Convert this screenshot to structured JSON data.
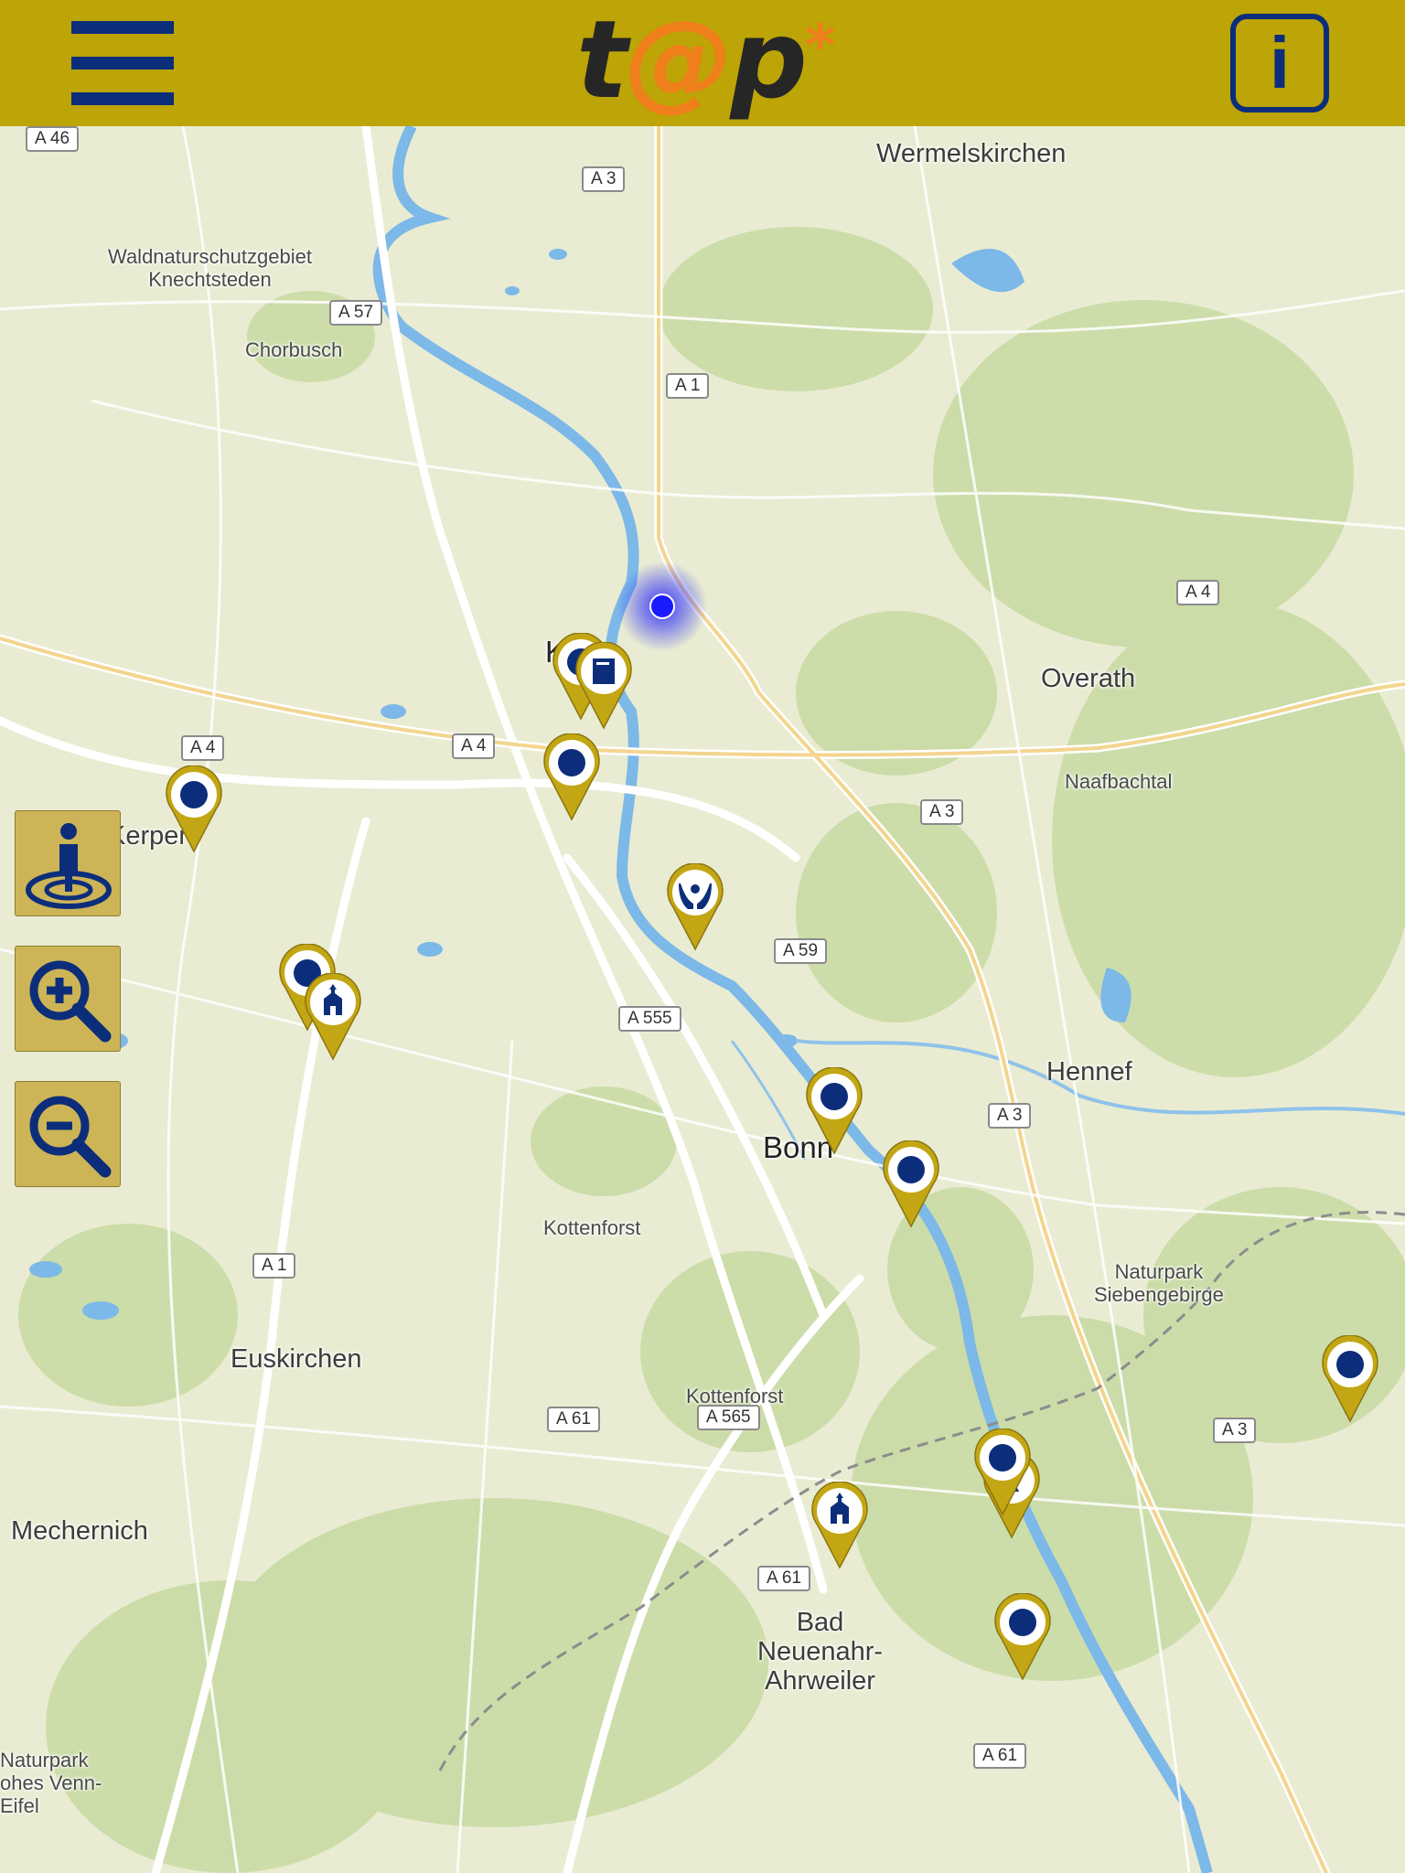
{
  "header": {
    "logo": {
      "t": "t",
      "at": "@",
      "p": "p",
      "star": "*"
    },
    "menu_icon": "hamburger-menu-icon",
    "info_label": "i",
    "colors": {
      "bar": "#bda407",
      "icon": "#0c2e7a",
      "logo_text": "#262626",
      "logo_accent": "#ef7f1a"
    }
  },
  "map": {
    "places": {
      "wermelskirchen": "Wermelskirchen",
      "knechtsteden": "Waldnaturschutzgebiet\nKnechtsteden",
      "chorbusch": "Chorbusch",
      "koeln": "Köln",
      "overath": "Overath",
      "naafbachtal": "Naafbachtal",
      "kerpen": "Kerpen",
      "hennef": "Hennef",
      "bonn": "Bonn",
      "kottenforst1": "Kottenforst",
      "kottenforst2": "Kottenforst",
      "siebengebirge": "Naturpark\nSiebengebirge",
      "euskirchen": "Euskirchen",
      "mechernich": "Mechernich",
      "ahrweiler": "Bad\nNeuenahr-\nAhrweiler",
      "hohesvenn": "Naturpark\nohes Venn-\nEifel"
    },
    "roads": {
      "a46": "A 46",
      "a3_n": "A 3",
      "a57": "A 57",
      "a1_n": "A 1",
      "a4_e": "A 4",
      "a4_w": "A 4",
      "a4_c": "A 4",
      "a3_e": "A 3",
      "a59": "A 59",
      "a555": "A 555",
      "a3_se": "A 3",
      "a1_s": "A 1",
      "a61_w": "A 61",
      "a565": "A 565",
      "a61_c": "A 61",
      "a3_far": "A 3",
      "a61_s": "A 61"
    },
    "markers": [
      {
        "name": "poi-marker",
        "icon": "dot-icon"
      },
      {
        "name": "poi-marker",
        "icon": "book-icon"
      },
      {
        "name": "poi-marker",
        "icon": "dot-icon"
      },
      {
        "name": "poi-marker",
        "icon": "dot-icon"
      },
      {
        "name": "poi-marker",
        "icon": "helping-hands-icon"
      },
      {
        "name": "poi-marker",
        "icon": "dot-icon"
      },
      {
        "name": "poi-marker",
        "icon": "church-icon"
      },
      {
        "name": "poi-marker",
        "icon": "dot-icon"
      },
      {
        "name": "poi-marker",
        "icon": "dot-icon"
      },
      {
        "name": "poi-marker",
        "icon": "church-icon"
      },
      {
        "name": "poi-marker",
        "icon": "person-icon"
      },
      {
        "name": "poi-marker",
        "icon": "dot-icon"
      },
      {
        "name": "poi-marker",
        "icon": "dot-icon"
      },
      {
        "name": "poi-marker",
        "icon": "dot-icon"
      }
    ],
    "colors": {
      "pin": "#c3a613",
      "pin_icon": "#0c2e7a",
      "water": "#7cb8e8",
      "land": "#e9ecd2",
      "forest": "#c5d9a2"
    }
  },
  "controls": {
    "locate": "locate-me-icon",
    "zoom_in": "zoom-in-icon",
    "zoom_out": "zoom-out-icon",
    "colors": {
      "bg": "#cdb457",
      "icon": "#0c2e7a"
    }
  }
}
